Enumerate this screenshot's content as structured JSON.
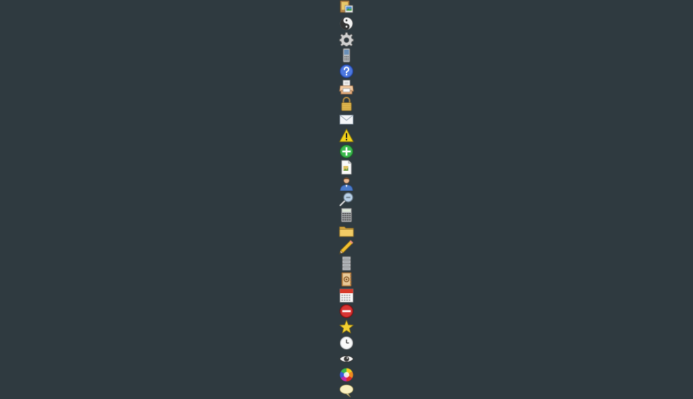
{
  "background_color": "#2f3a40",
  "icons": [
    {
      "name": "photos-icon"
    },
    {
      "name": "yin-yang-icon"
    },
    {
      "name": "gear-icon"
    },
    {
      "name": "mobile-phone-icon"
    },
    {
      "name": "help-icon"
    },
    {
      "name": "printer-icon"
    },
    {
      "name": "lock-icon"
    },
    {
      "name": "mail-icon"
    },
    {
      "name": "warning-icon"
    },
    {
      "name": "add-icon"
    },
    {
      "name": "document-image-icon"
    },
    {
      "name": "user-icon"
    },
    {
      "name": "zoom-out-icon"
    },
    {
      "name": "calculator-icon"
    },
    {
      "name": "folder-icon"
    },
    {
      "name": "pencil-icon"
    },
    {
      "name": "database-icon"
    },
    {
      "name": "address-book-icon"
    },
    {
      "name": "calendar-icon"
    },
    {
      "name": "remove-icon"
    },
    {
      "name": "star-icon"
    },
    {
      "name": "clock-icon"
    },
    {
      "name": "eye-icon"
    },
    {
      "name": "color-wheel-icon"
    },
    {
      "name": "speech-bubble-icon"
    }
  ]
}
